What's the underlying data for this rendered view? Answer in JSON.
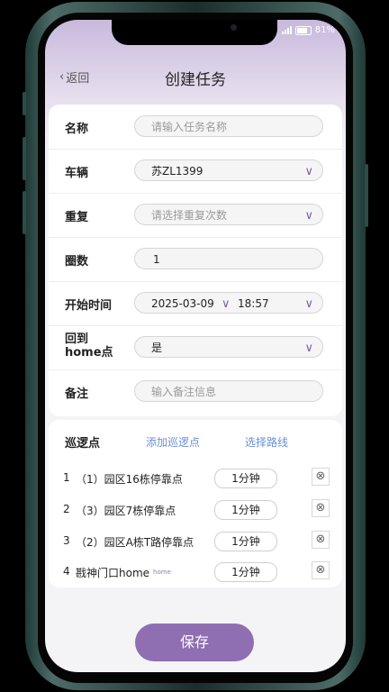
{
  "status_bar": {
    "battery": "81%"
  },
  "header": {
    "back_label": "返回",
    "title": "创建任务"
  },
  "form": {
    "name": {
      "label": "名称",
      "placeholder": "请输入任务名称"
    },
    "vehicle": {
      "label": "车辆",
      "value": "苏ZL1399"
    },
    "repeat": {
      "label": "重复",
      "placeholder": "请选择重复次数"
    },
    "laps": {
      "label": "圈数",
      "value": "1"
    },
    "start_time": {
      "label": "开始时间",
      "date": "2025-03-09",
      "time": "18:57"
    },
    "return_home": {
      "label_line1": "回到",
      "label_line2": "home点",
      "value": "是"
    },
    "note": {
      "label": "备注",
      "placeholder": "输入备注信息"
    }
  },
  "patrol": {
    "label": "巡逻点",
    "add_label": "添加巡逻点",
    "route_label": "选择路线",
    "points": [
      {
        "num": "1",
        "name": "（1）园区16栋停靠点",
        "tag": "",
        "duration": "1分钟"
      },
      {
        "num": "2",
        "name": "（3）园区7栋停靠点",
        "tag": "",
        "duration": "1分钟"
      },
      {
        "num": "3",
        "name": "（2）园区A栋T路停靠点",
        "tag": "",
        "duration": "1分钟"
      },
      {
        "num": "4",
        "name": "戡神门口home",
        "tag": "home",
        "duration": "1分钟"
      }
    ]
  },
  "save_label": "保存",
  "colors": {
    "accent": "#8f6eb2",
    "chevron": "#7a5ea8",
    "link": "#6b8fd6"
  }
}
